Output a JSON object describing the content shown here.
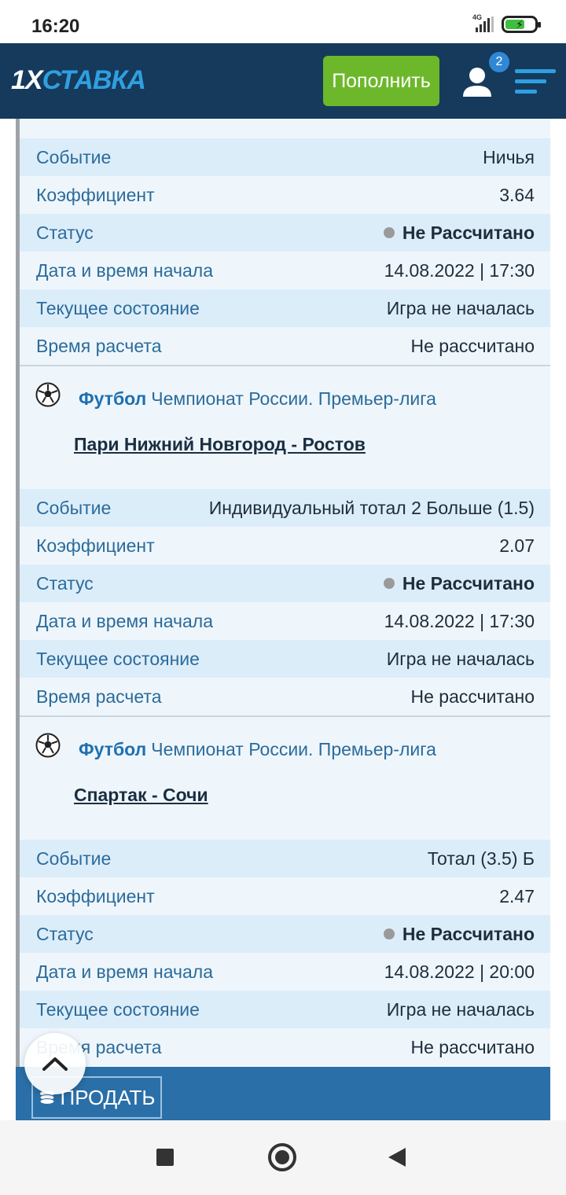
{
  "status_bar": {
    "time": "16:20",
    "network": "4G"
  },
  "header": {
    "logo_prefix": "1X",
    "logo_suffix": "СТАВКА",
    "deposit_label": "Пополнить",
    "notifications_count": "2",
    "brand_color": "#153a5c",
    "deposit_color": "#6cb82a"
  },
  "bet1": {
    "rows": [
      {
        "label": "Событие",
        "value": "Ничья"
      },
      {
        "label": "Коэффициент",
        "value": "3.64"
      },
      {
        "label": "Статус",
        "value": "Не Рассчитано"
      },
      {
        "label": "Дата и время начала",
        "value": "14.08.2022 | 17:30"
      },
      {
        "label": "Текущее состояние",
        "value": "Игра не началась"
      },
      {
        "label": "Время расчета",
        "value": "Не рассчитано"
      }
    ]
  },
  "bet2": {
    "sport": "Футбол",
    "league": "Чемпионат России. Премьер-лига",
    "match": "Пари Нижний Новгород - Ростов",
    "rows": [
      {
        "label": "Событие",
        "value": "Индивидуальный тотал 2 Больше (1.5)"
      },
      {
        "label": "Коэффициент",
        "value": "2.07"
      },
      {
        "label": "Статус",
        "value": "Не Рассчитано"
      },
      {
        "label": "Дата и время начала",
        "value": "14.08.2022 | 17:30"
      },
      {
        "label": "Текущее состояние",
        "value": "Игра не началась"
      },
      {
        "label": "Время расчета",
        "value": "Не рассчитано"
      }
    ]
  },
  "bet3": {
    "sport": "Футбол",
    "league": "Чемпионат России. Премьер-лига",
    "match": "Спартак - Сочи",
    "rows": [
      {
        "label": "Событие",
        "value": "Тотал (3.5) Б"
      },
      {
        "label": "Коэффициент",
        "value": "2.47"
      },
      {
        "label": "Статус",
        "value": "Не Рассчитано"
      },
      {
        "label": "Дата и время начала",
        "value": "14.08.2022 | 20:00"
      },
      {
        "label": "Текущее состояние",
        "value": "Игра не началась"
      },
      {
        "label": "Время расчета",
        "value": "Не рассчитано"
      }
    ]
  },
  "footer": {
    "sell_label": "ПРОДАТЬ"
  }
}
